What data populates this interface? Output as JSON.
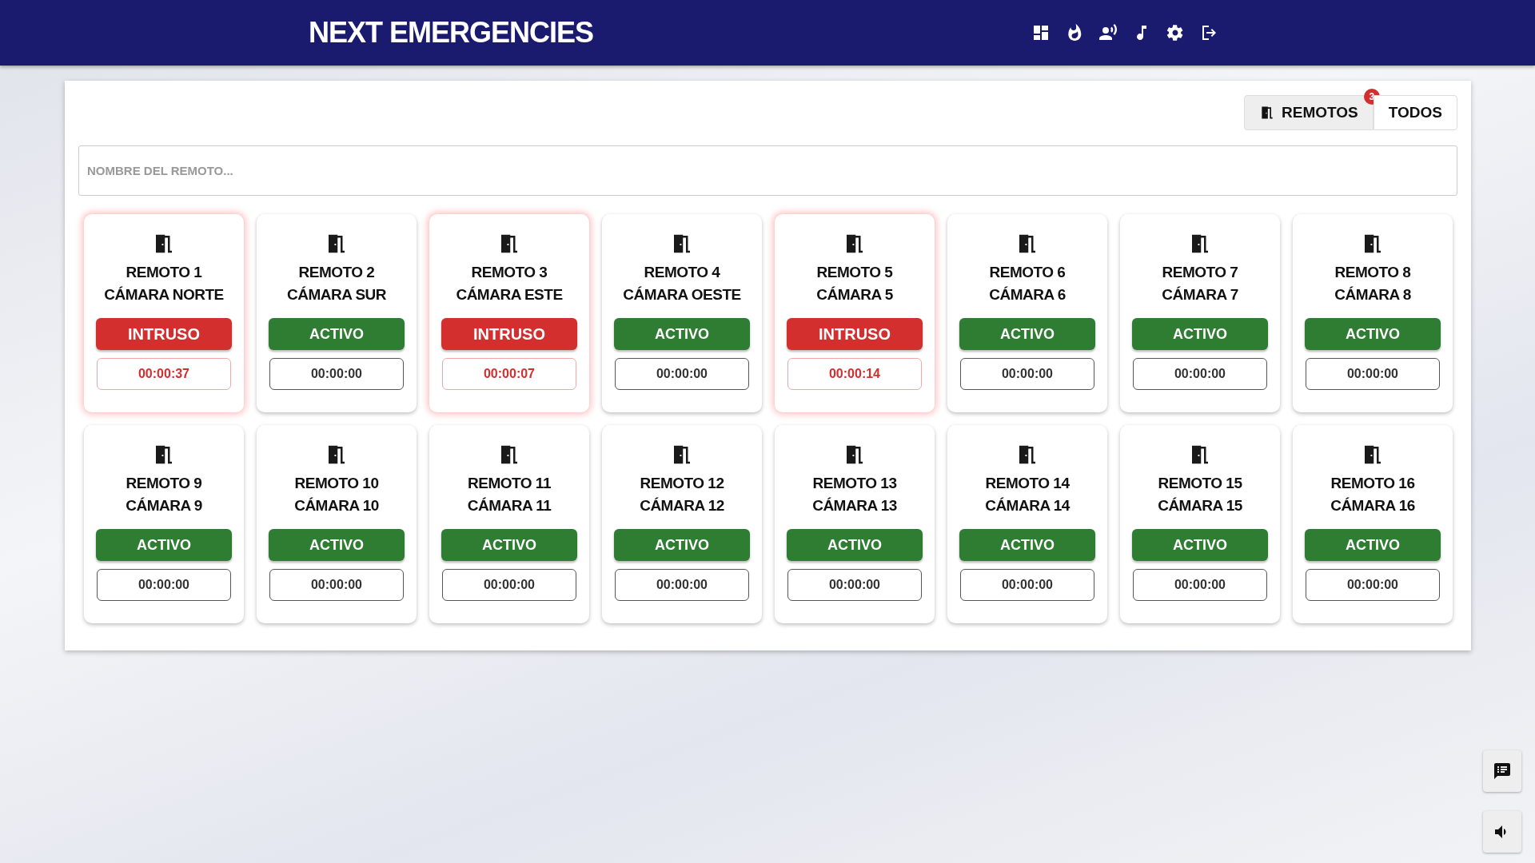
{
  "header": {
    "title": "NEXT EMERGENCIES",
    "nav": [
      {
        "kind": "dashboard"
      },
      {
        "kind": "fire"
      },
      {
        "kind": "speaker"
      },
      {
        "kind": "music"
      },
      {
        "kind": "settings"
      },
      {
        "kind": "logout"
      }
    ]
  },
  "filter": {
    "tabs": [
      {
        "label": "REMOTOS",
        "selected": true,
        "badge": "3"
      },
      {
        "label": "TODOS",
        "selected": false
      }
    ]
  },
  "search": {
    "placeholder": "NOMBRE DEL REMOTO..."
  },
  "cards": [
    {
      "name": "REMOTO 1",
      "camera": "CÁMARA NORTE",
      "status": "INTRUSO",
      "kind": "alarm",
      "timer": "00:00:37"
    },
    {
      "name": "REMOTO 2",
      "camera": "CÁMARA SUR",
      "status": "ACTIVO",
      "kind": "ok",
      "timer": "00:00:00"
    },
    {
      "name": "REMOTO 3",
      "camera": "CÁMARA ESTE",
      "status": "INTRUSO",
      "kind": "alarm",
      "timer": "00:00:07"
    },
    {
      "name": "REMOTO 4",
      "camera": "CÁMARA OESTE",
      "status": "ACTIVO",
      "kind": "ok",
      "timer": "00:00:00"
    },
    {
      "name": "REMOTO 5",
      "camera": "CÁMARA 5",
      "status": "INTRUSO",
      "kind": "alarm",
      "timer": "00:00:14"
    },
    {
      "name": "REMOTO 6",
      "camera": "CÁMARA 6",
      "status": "ACTIVO",
      "kind": "ok",
      "timer": "00:00:00"
    },
    {
      "name": "REMOTO 7",
      "camera": "CÁMARA 7",
      "status": "ACTIVO",
      "kind": "ok",
      "timer": "00:00:00"
    },
    {
      "name": "REMOTO 8",
      "camera": "CÁMARA 8",
      "status": "ACTIVO",
      "kind": "ok",
      "timer": "00:00:00"
    },
    {
      "name": "REMOTO 9",
      "camera": "CÁMARA 9",
      "status": "ACTIVO",
      "kind": "ok",
      "timer": "00:00:00"
    },
    {
      "name": "REMOTO 10",
      "camera": "CÁMARA 10",
      "status": "ACTIVO",
      "kind": "ok",
      "timer": "00:00:00"
    },
    {
      "name": "REMOTO 11",
      "camera": "CÁMARA 11",
      "status": "ACTIVO",
      "kind": "ok",
      "timer": "00:00:00"
    },
    {
      "name": "REMOTO 12",
      "camera": "CÁMARA 12",
      "status": "ACTIVO",
      "kind": "ok",
      "timer": "00:00:00"
    },
    {
      "name": "REMOTO 13",
      "camera": "CÁMARA 13",
      "status": "ACTIVO",
      "kind": "ok",
      "timer": "00:00:00"
    },
    {
      "name": "REMOTO 14",
      "camera": "CÁMARA 14",
      "status": "ACTIVO",
      "kind": "ok",
      "timer": "00:00:00"
    },
    {
      "name": "REMOTO 15",
      "camera": "CÁMARA 15",
      "status": "ACTIVO",
      "kind": "ok",
      "timer": "00:00:00"
    },
    {
      "name": "REMOTO 16",
      "camera": "CÁMARA 16",
      "status": "ACTIVO",
      "kind": "ok",
      "timer": "00:00:00"
    }
  ],
  "side_buttons": [
    {
      "kind": "messages"
    },
    {
      "kind": "volume"
    }
  ]
}
